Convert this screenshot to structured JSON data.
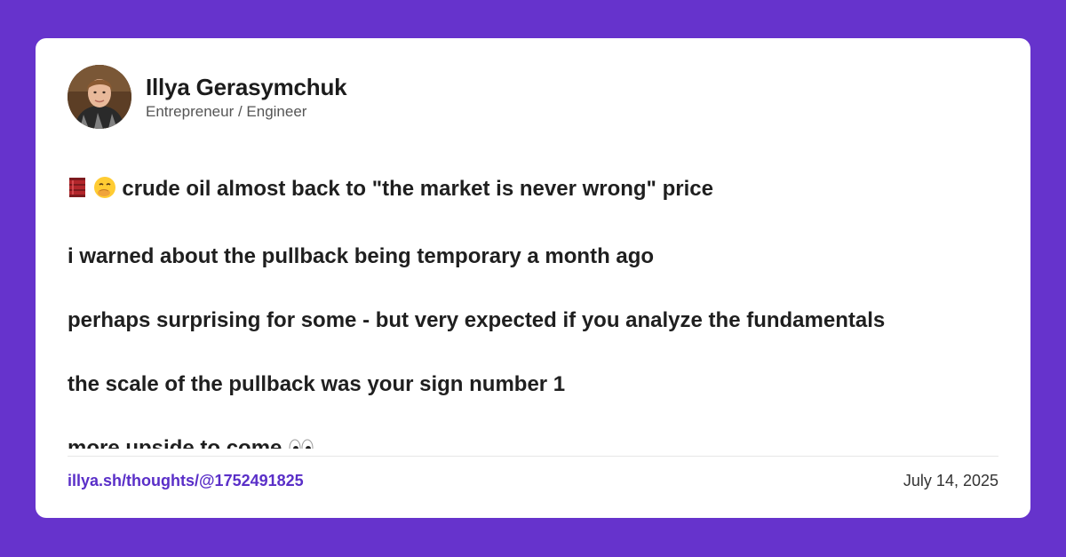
{
  "author": {
    "name": "Illya Gerasymchuk",
    "title": "Entrepreneur / Engineer"
  },
  "post": {
    "lead_icons": [
      "oil-drum-icon",
      "face-with-hand-over-mouth-icon"
    ],
    "paragraphs": [
      "crude oil almost back to \"the market is never wrong\" price",
      "i warned about the pullback being temporary a month ago",
      "perhaps surprising for some - but very expected if you analyze the fundamentals",
      "the scale of the pullback was your sign number 1",
      "more upside to come"
    ],
    "trailing_icon": "eyes-icon"
  },
  "footer": {
    "link": "illya.sh/thoughts/@1752491825",
    "date": "July 14, 2025"
  },
  "colors": {
    "background": "#6633CC",
    "card": "#FFFFFF",
    "link": "#5A2FC8"
  }
}
